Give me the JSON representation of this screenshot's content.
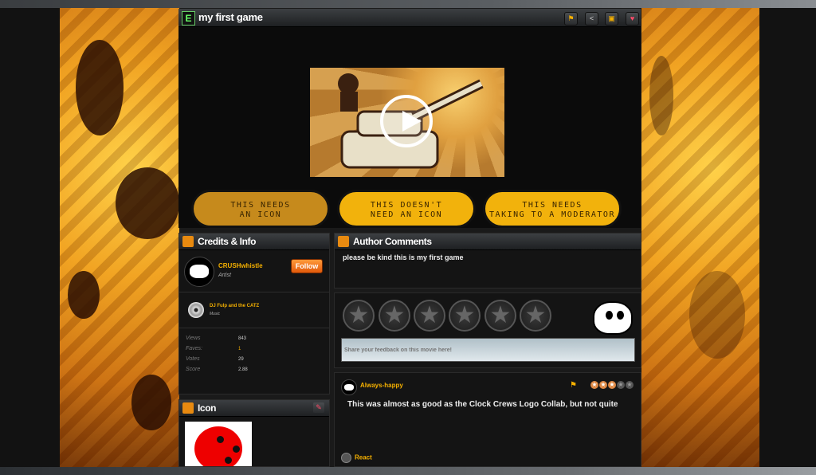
{
  "game": {
    "title": "my first game",
    "header_icons": [
      "flag-icon",
      "share-icon",
      "comments-icon",
      "heart-icon"
    ]
  },
  "buttons": [
    {
      "label": "THIS NEEDS\nAN ICON"
    },
    {
      "label": "THIS DOESN'T\nNEED AN ICON"
    },
    {
      "label": "THIS NEEDS\nTAKING TO A MODERATOR"
    }
  ],
  "credits": {
    "title": "Credits & Info",
    "people": [
      {
        "name": "CRUSHwhistle",
        "role": "Artist",
        "follow_label": "Follow"
      },
      {
        "name": "DJ Fulp and the CATZ",
        "role": "Music"
      }
    ],
    "stats": [
      {
        "label": "Views",
        "value": "843"
      },
      {
        "label": "Faves:",
        "value": "1"
      },
      {
        "label": "Votes",
        "value": "29"
      },
      {
        "label": "Score",
        "value": "2.88"
      }
    ]
  },
  "icon_panel": {
    "title": "Icon"
  },
  "author_comments": {
    "title": "Author Comments",
    "text": "please be kind this is my first game"
  },
  "rating": {
    "feedback_placeholder": "Share your feedback on this movie here!"
  },
  "review": {
    "author": "Always-happy",
    "stars": 3,
    "max_stars": 5,
    "text": "This was almost as good as the Clock Crews Logo Collab, but not quite",
    "react_label": "React"
  }
}
